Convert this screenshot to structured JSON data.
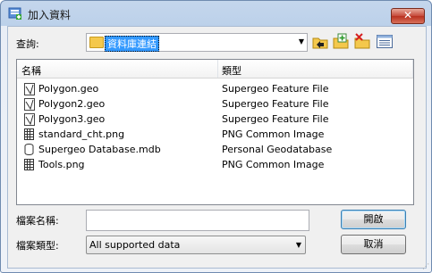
{
  "window": {
    "title": "加入資料",
    "close_label": "✕"
  },
  "lookin": {
    "label": "查詢:",
    "value": "資料庫連結"
  },
  "toolbar": {
    "icons": [
      "up-folder-icon",
      "new-folder-icon",
      "delete-folder-icon",
      "view-menu-icon"
    ]
  },
  "list": {
    "headers": {
      "name": "名稱",
      "type": "類型"
    },
    "rows": [
      {
        "name": "Polygon.geo",
        "type": "Supergeo Feature File",
        "icon": "geo-file-icon"
      },
      {
        "name": "Polygon2.geo",
        "type": "Supergeo Feature File",
        "icon": "geo-file-icon"
      },
      {
        "name": "Polygon3.geo",
        "type": "Supergeo Feature File",
        "icon": "geo-file-icon"
      },
      {
        "name": "standard_cht.png",
        "type": "PNG Common Image",
        "icon": "image-file-icon"
      },
      {
        "name": "Supergeo Database.mdb",
        "type": "Personal Geodatabase",
        "icon": "database-file-icon"
      },
      {
        "name": "Tools.png",
        "type": "PNG Common Image",
        "icon": "image-file-icon"
      }
    ]
  },
  "form": {
    "filename_label": "檔案名稱:",
    "filename_value": "",
    "filetype_label": "檔案類型:",
    "filetype_value": "All supported data"
  },
  "buttons": {
    "open": "開啟",
    "cancel": "取消"
  }
}
